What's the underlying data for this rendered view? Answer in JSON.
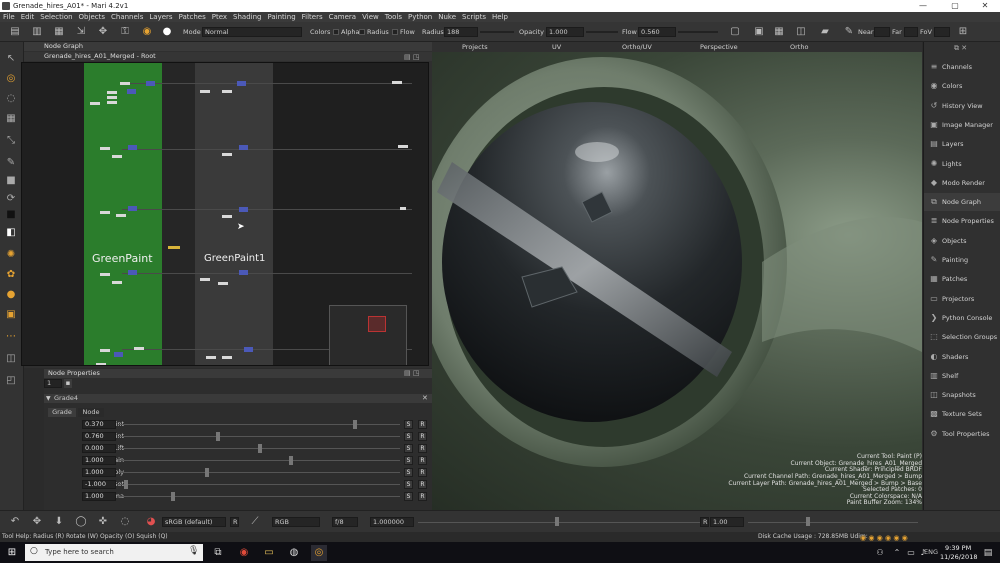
{
  "window": {
    "title": "Grenade_hires_A01* - Mari 4.2v1",
    "controls": [
      "—",
      "▢",
      "✕"
    ]
  },
  "menu": [
    "File",
    "Edit",
    "Selection",
    "Objects",
    "Channels",
    "Layers",
    "Patches",
    "Ptex",
    "Shading",
    "Painting",
    "Filters",
    "Camera",
    "View",
    "Tools",
    "Python",
    "Nuke",
    "Scripts",
    "Help"
  ],
  "toolbar": {
    "mode_label": "Mode",
    "mode_value": "Normal",
    "colors_label": "Colors",
    "alpha_label": "Alpha",
    "radius_check_label": "Radius",
    "flow_check_label": "Flow",
    "radius_label": "Radius",
    "radius_value": "188",
    "opacity_label": "Opacity",
    "opacity_value": "1.000",
    "flow_label": "Flow",
    "flow_value": "0.560",
    "near_label": "Near",
    "far_label": "Far",
    "fov_label": "FoV"
  },
  "node_graph": {
    "panel_title": "Node Graph",
    "breadcrumb": "Grenade_hires_A01_Merged - Root",
    "backdrop1_label": "GreenPaint",
    "backdrop2_label": "GreenPaint1"
  },
  "node_properties": {
    "panel_title": "Node Properties",
    "count_value": "1",
    "node_name": "Grade4",
    "tabs": [
      "Grade",
      "Node"
    ],
    "params": [
      {
        "label": "Blackpoint",
        "value": "0.370",
        "pos": 0.84
      },
      {
        "label": "Whitepoint",
        "value": "0.760",
        "pos": 0.35
      },
      {
        "label": "Lift",
        "value": "0.000",
        "pos": 0.5
      },
      {
        "label": "Gain",
        "value": "1.000",
        "pos": 0.61
      },
      {
        "label": "Multiply",
        "value": "1.000",
        "pos": 0.31
      },
      {
        "label": "Offset",
        "value": "-1.000",
        "pos": 0.02
      },
      {
        "label": "Gamma",
        "value": "1.000",
        "pos": 0.19
      }
    ],
    "s_label": "S",
    "r_label": "R"
  },
  "viewport": {
    "tabs": [
      "Projects",
      "UV",
      "Ortho/UV",
      "Perspective",
      "Ortho"
    ],
    "hud": [
      "Current Tool: Paint (P)",
      "Current Object: Grenade_hires_A01_Merged",
      "Current Shader: Principled BRDF",
      "Current Channel Path: Grenade_hires_A01_Merged > Bump",
      "Current Layer Path: Grenade_hires_A01_Merged > Bump > Base",
      "Selected Patches: 0",
      "Current Colorspace: N/A",
      "Paint Buffer Zoom: 134%"
    ]
  },
  "right_panel": [
    {
      "label": "Channels",
      "icon": "≡"
    },
    {
      "label": "Colors",
      "icon": "◉"
    },
    {
      "label": "History View",
      "icon": "↺"
    },
    {
      "label": "Image Manager",
      "icon": "▣"
    },
    {
      "label": "Layers",
      "icon": "▤"
    },
    {
      "label": "Lights",
      "icon": "✺"
    },
    {
      "label": "Modo Render",
      "icon": "◆"
    },
    {
      "label": "Node Graph",
      "icon": "⧉"
    },
    {
      "label": "Node Properties",
      "icon": "≣"
    },
    {
      "label": "Objects",
      "icon": "◈"
    },
    {
      "label": "Painting",
      "icon": "✎"
    },
    {
      "label": "Patches",
      "icon": "▦"
    },
    {
      "label": "Projectors",
      "icon": "▭"
    },
    {
      "label": "Python Console",
      "icon": "❯"
    },
    {
      "label": "Selection Groups",
      "icon": "⬚"
    },
    {
      "label": "Shaders",
      "icon": "◐"
    },
    {
      "label": "Shelf",
      "icon": "▥"
    },
    {
      "label": "Snapshots",
      "icon": "◫"
    },
    {
      "label": "Texture Sets",
      "icon": "▩"
    },
    {
      "label": "Tool Properties",
      "icon": "⚙"
    }
  ],
  "bottom_bar": {
    "colorspace_value": "sRGB (default)",
    "channel_value": "RGB",
    "fstop_value": "f/8",
    "exposure_value": "1.000000",
    "r_label": "R",
    "gamma_value": "1.00"
  },
  "status": {
    "tool_help": "Tool Help:   Radius (R)    Rotate (W)    Opacity (O)    Squish (Q)",
    "disk_cache": "Disk Cache Usage : 728.85MB  Udim:"
  },
  "taskbar": {
    "search_placeholder": "Type here to search",
    "language": "ENG",
    "time": "9:39 PM",
    "date": "11/26/2018"
  },
  "colors": {
    "backdrop_green": "#2b7d2c",
    "backdrop_gray": "#3a3a3a",
    "node_blue": "#4b59b8"
  }
}
